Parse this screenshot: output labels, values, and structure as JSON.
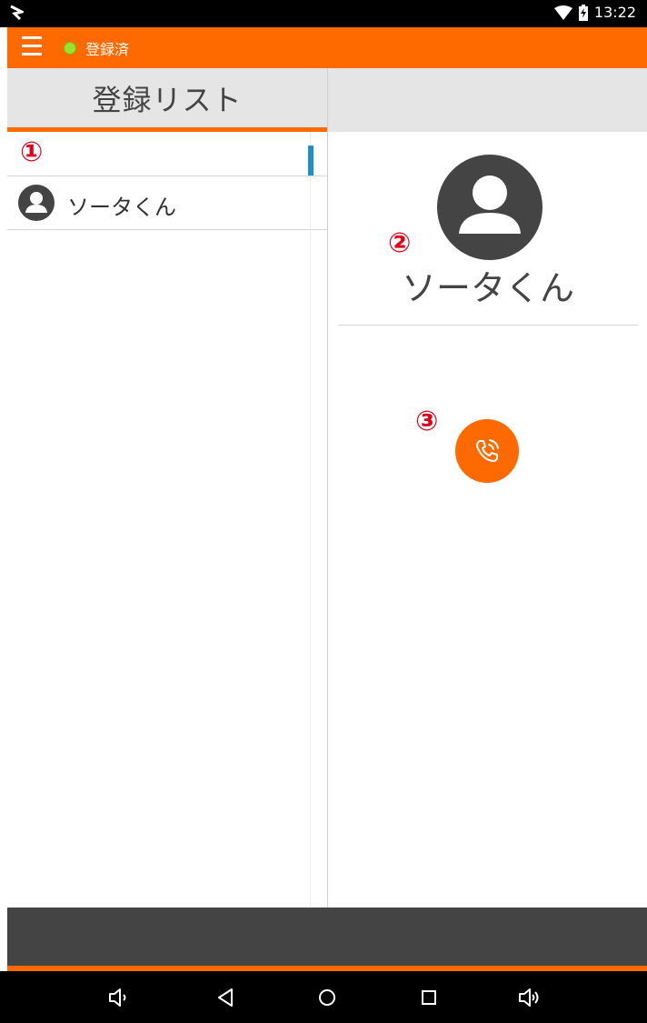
{
  "status_bar": {
    "time": "13:22",
    "icons": [
      "app-logo-icon",
      "wifi-icon",
      "battery-charging-icon"
    ]
  },
  "app_bar": {
    "status_label": "登録済",
    "status_color": "#9be22f",
    "accent_color": "#ff6a00"
  },
  "left_panel": {
    "title": "登録リスト",
    "items": [
      {
        "name": "ソータくん"
      }
    ]
  },
  "detail": {
    "name": "ソータくん"
  },
  "annotations": {
    "one": "①",
    "two": "②",
    "three": "③"
  },
  "navigation": {
    "buttons": [
      "volume-down-icon",
      "back-icon",
      "home-icon",
      "recents-icon",
      "volume-up-icon"
    ]
  }
}
